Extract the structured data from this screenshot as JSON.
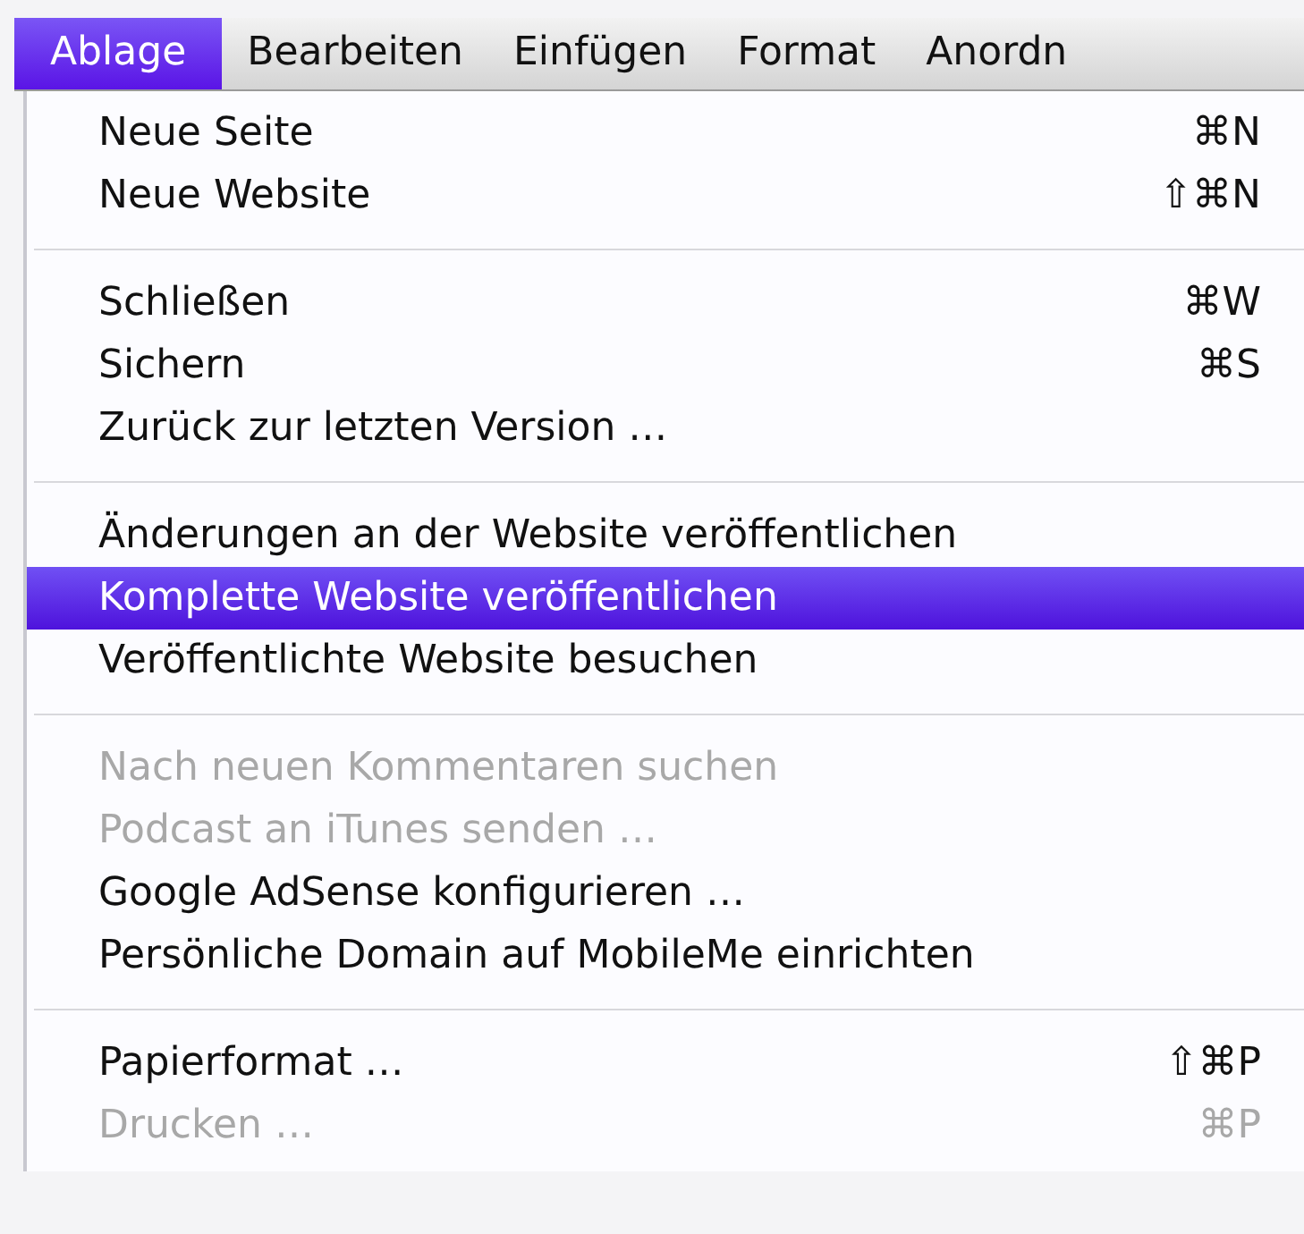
{
  "menu_bar": [
    {
      "label": "Ablage",
      "selected": true
    },
    {
      "label": "Bearbeiten",
      "selected": false
    },
    {
      "label": "Einfügen",
      "selected": false
    },
    {
      "label": "Format",
      "selected": false
    },
    {
      "label": "Anordn",
      "selected": false
    }
  ],
  "menu": {
    "groups": [
      {
        "items": [
          {
            "label": "Neue Seite",
            "shortcut": "⌘N",
            "disabled": false,
            "selected": false
          },
          {
            "label": "Neue Website",
            "shortcut": "⇧⌘N",
            "disabled": false,
            "selected": false
          }
        ]
      },
      {
        "items": [
          {
            "label": "Schließen",
            "shortcut": "⌘W",
            "disabled": false,
            "selected": false
          },
          {
            "label": "Sichern",
            "shortcut": "⌘S",
            "disabled": false,
            "selected": false
          },
          {
            "label": "Zurück zur letzten Version …",
            "disabled": false,
            "selected": false
          }
        ]
      },
      {
        "items": [
          {
            "label": "Änderungen an der Website veröffentlichen",
            "disabled": false,
            "selected": false
          },
          {
            "label": "Komplette Website veröffentlichen",
            "disabled": false,
            "selected": true
          },
          {
            "label": "Veröffentlichte Website besuchen",
            "disabled": false,
            "selected": false
          }
        ]
      },
      {
        "items": [
          {
            "label": "Nach neuen Kommentaren suchen",
            "disabled": true,
            "selected": false
          },
          {
            "label": "Podcast an iTunes senden …",
            "disabled": true,
            "selected": false
          },
          {
            "label": "Google AdSense konfigurieren …",
            "disabled": false,
            "selected": false
          },
          {
            "label": "Persönliche Domain auf MobileMe einrichten",
            "disabled": false,
            "selected": false
          }
        ]
      },
      {
        "items": [
          {
            "label": "Papierformat …",
            "shortcut": "⇧⌘P",
            "disabled": false,
            "selected": false
          },
          {
            "label": "Drucken …",
            "shortcut": "⌘P",
            "disabled": true,
            "selected": false
          }
        ]
      }
    ]
  }
}
